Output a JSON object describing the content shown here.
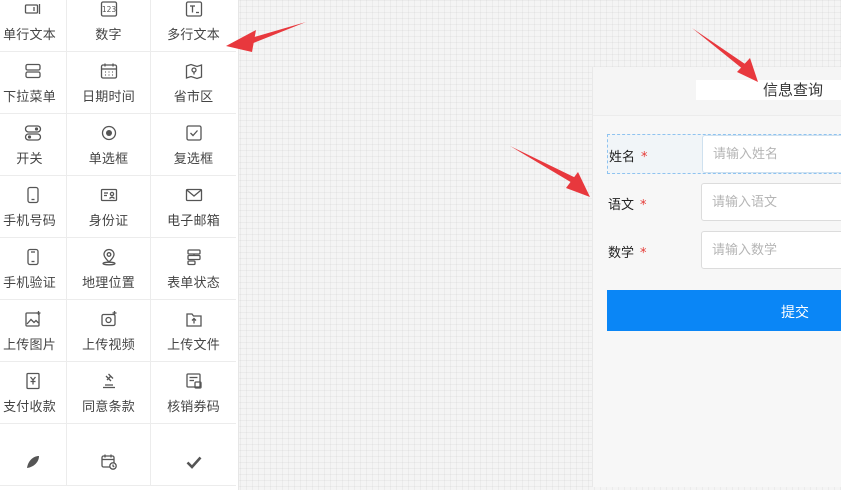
{
  "palette": {
    "items": [
      {
        "label": "单行文本",
        "icon": "single-line-text-icon"
      },
      {
        "label": "数字",
        "icon": "number-icon"
      },
      {
        "label": "多行文本",
        "icon": "multi-line-text-icon"
      },
      {
        "label": "下拉菜单",
        "icon": "dropdown-icon"
      },
      {
        "label": "日期时间",
        "icon": "calendar-icon"
      },
      {
        "label": "省市区",
        "icon": "map-region-icon"
      },
      {
        "label": "开关",
        "icon": "toggle-icon"
      },
      {
        "label": "单选框",
        "icon": "radio-icon"
      },
      {
        "label": "复选框",
        "icon": "checkbox-icon"
      },
      {
        "label": "手机号码",
        "icon": "phone-icon"
      },
      {
        "label": "身份证",
        "icon": "id-card-icon"
      },
      {
        "label": "电子邮箱",
        "icon": "email-icon"
      },
      {
        "label": "手机验证",
        "icon": "phone-verify-icon"
      },
      {
        "label": "地理位置",
        "icon": "location-icon"
      },
      {
        "label": "表单状态",
        "icon": "form-status-icon"
      },
      {
        "label": "上传图片",
        "icon": "upload-image-icon"
      },
      {
        "label": "上传视频",
        "icon": "upload-video-icon"
      },
      {
        "label": "上传文件",
        "icon": "upload-file-icon"
      },
      {
        "label": "支付收款",
        "icon": "payment-icon"
      },
      {
        "label": "同意条款",
        "icon": "agreement-icon"
      },
      {
        "label": "核销券码",
        "icon": "coupon-icon"
      },
      {
        "label": "",
        "icon": "feather-icon"
      },
      {
        "label": "",
        "icon": "calendar-clock-icon"
      },
      {
        "label": "",
        "icon": "checkmark-icon"
      }
    ]
  },
  "form": {
    "title": "信息查询",
    "fields": [
      {
        "label": "姓名",
        "required_mark": "*",
        "placeholder": "请输入姓名"
      },
      {
        "label": "语文",
        "required_mark": "*",
        "placeholder": "请输入语文"
      },
      {
        "label": "数学",
        "required_mark": "*",
        "placeholder": "请输入数学"
      }
    ],
    "submit_label": "提交"
  },
  "colors": {
    "accent": "#0a86f6",
    "required": "#e53935",
    "arrow": "#e8383d"
  }
}
